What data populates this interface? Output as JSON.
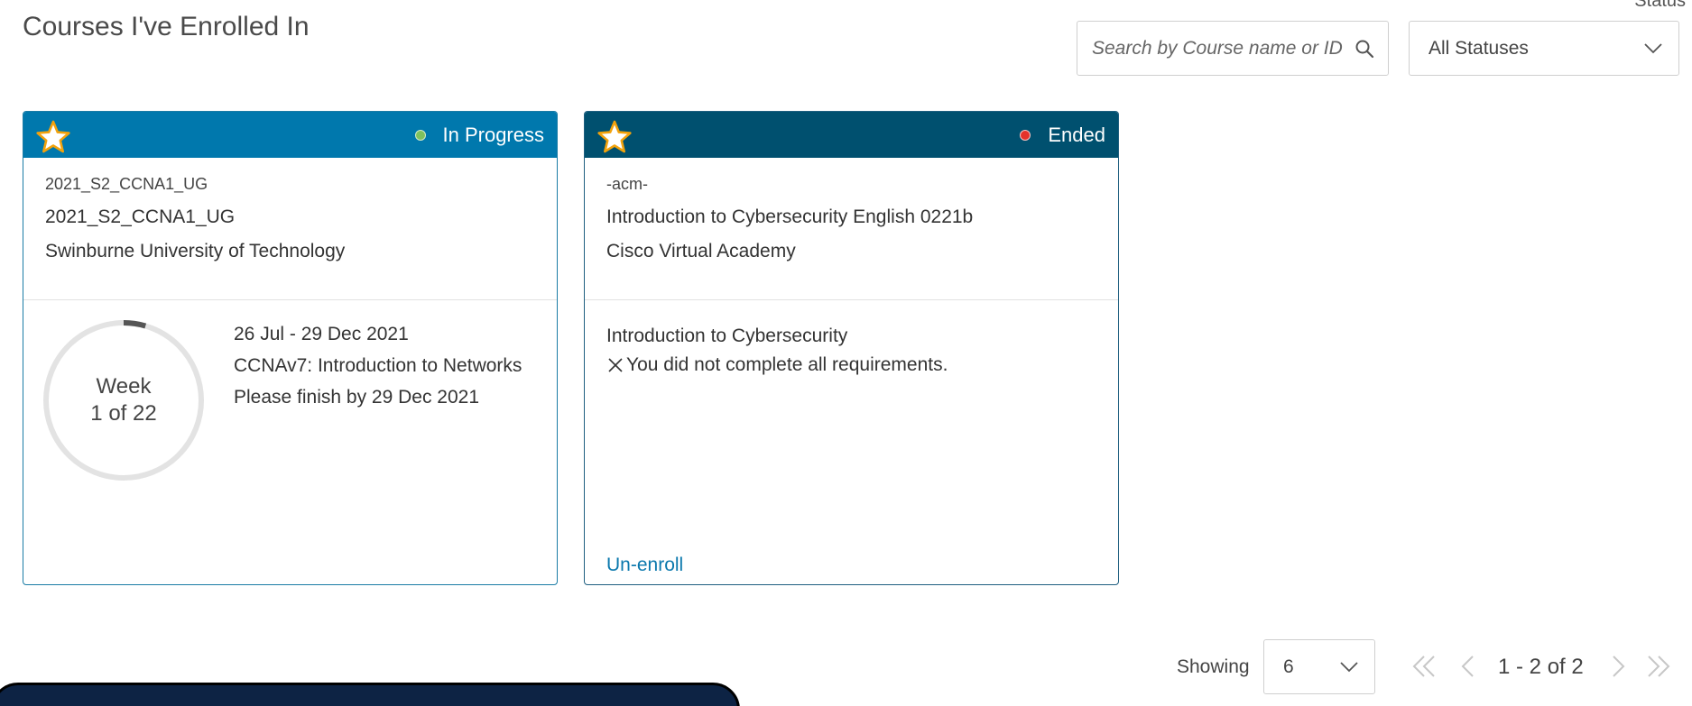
{
  "page": {
    "title": "Courses I've Enrolled In"
  },
  "filters": {
    "status_label": "Status",
    "search_placeholder": "Search by Course name or ID",
    "status_selected": "All Statuses"
  },
  "courses": [
    {
      "status": "In Progress",
      "status_color": "#7fc15e",
      "header_color": "#0078ad",
      "code": "2021_S2_CCNA1_UG",
      "name": "2021_S2_CCNA1_UG",
      "institution": "Swinburne University of Technology",
      "progress": {
        "label": "Week",
        "value": "1 of 22",
        "current_week": 1,
        "total_weeks": 22
      },
      "dates": "26 Jul - 29 Dec 2021",
      "curriculum": "CCNAv7: Introduction to Networks",
      "deadline": "Please finish by 29 Dec 2021"
    },
    {
      "status": "Ended",
      "status_color": "#e4322b",
      "header_color": "#00506f",
      "code": "-acm-",
      "name": "Introduction to Cybersecurity English 0221b",
      "institution": "Cisco Virtual Academy",
      "curriculum": "Introduction to Cybersecurity",
      "requirement_note": "You did not complete all requirements.",
      "action": "Un-enroll"
    }
  ],
  "pagination": {
    "showing_label": "Showing",
    "page_size": "6",
    "range": "1 - 2 of 2"
  },
  "icons": [
    "star-icon",
    "search-icon",
    "chevron-down-icon",
    "x-icon",
    "first-page-icon",
    "prev-page-icon",
    "next-page-icon",
    "last-page-icon"
  ]
}
